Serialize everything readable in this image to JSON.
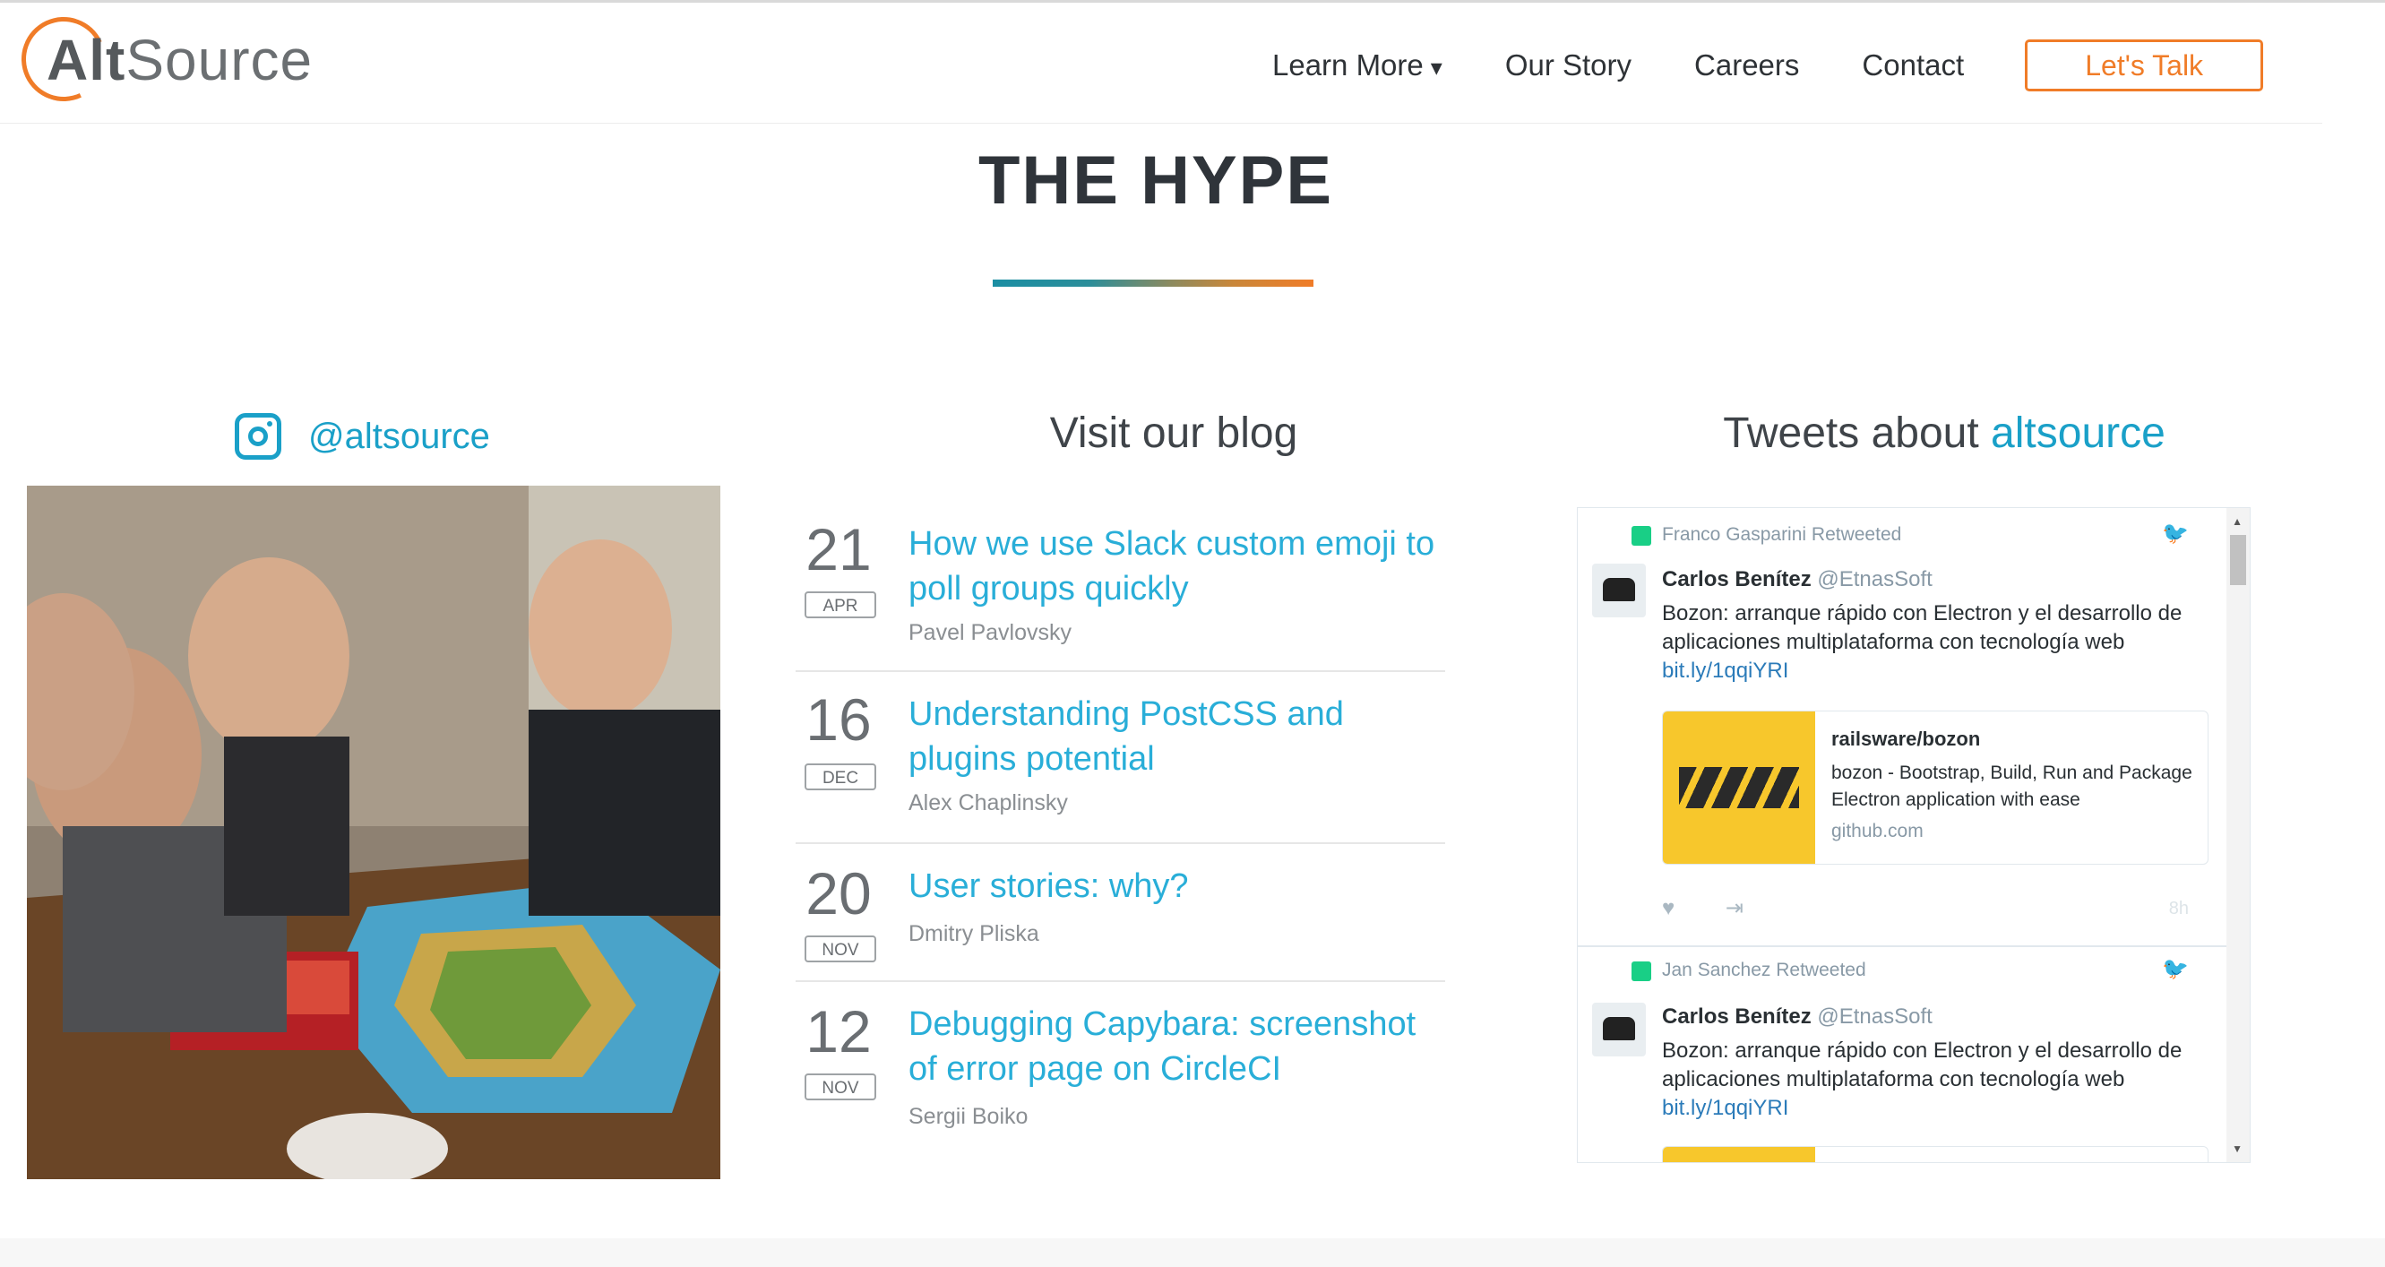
{
  "header": {
    "logo_alt": "Alt",
    "logo_source": "Source",
    "nav": [
      "Learn More",
      "Our Story",
      "Careers",
      "Contact"
    ],
    "nav_caret": "▾",
    "cta": "Let's Talk"
  },
  "hype": {
    "title": "THE HYPE"
  },
  "instagram": {
    "handle": "@altsource"
  },
  "blog": {
    "heading": "Visit our blog",
    "posts": [
      {
        "day": "21",
        "month": "APR",
        "title": "How we use Slack custom emoji to poll groups quickly",
        "author": "Pavel Pavlovsky"
      },
      {
        "day": "16",
        "month": "DEC",
        "title": "Understanding PostCSS and plugins potential",
        "author": "Alex Chaplinsky"
      },
      {
        "day": "20",
        "month": "NOV",
        "title": "User stories: why?",
        "author": "Dmitry Pliska"
      },
      {
        "day": "12",
        "month": "NOV",
        "title": "Debugging Capybara: screenshot of error page on CircleCI",
        "author": "Sergii Boiko"
      }
    ]
  },
  "tweets": {
    "heading_prefix": "Tweets about",
    "heading_accent": "altsource",
    "items": [
      {
        "retweeted_by": "Franco Gasparini Retweeted",
        "name": "Carlos Benítez",
        "handle": "@EtnasSoft",
        "text": "Bozon: arranque rápido con Electron y el desarrollo de aplicaciones multiplataforma con tecnología web",
        "link": "bit.ly/1qqiYRI",
        "card_title": "railsware/bozon",
        "card_desc": "bozon - Bootstrap, Build, Run and Package Electron application with ease",
        "card_site": "github.com",
        "time": "8h"
      },
      {
        "retweeted_by": "Jan Sanchez Retweeted",
        "name": "Carlos Benítez",
        "handle": "@EtnasSoft",
        "text": "Bozon: arranque rápido con Electron y el desarrollo de aplicaciones multiplataforma con tecnología web",
        "link": "bit.ly/1qqiYRI"
      }
    ]
  },
  "colors": {
    "accent_orange": "#f07c28",
    "accent_blue": "#1aa0c8",
    "link_blue": "#29aed8"
  }
}
